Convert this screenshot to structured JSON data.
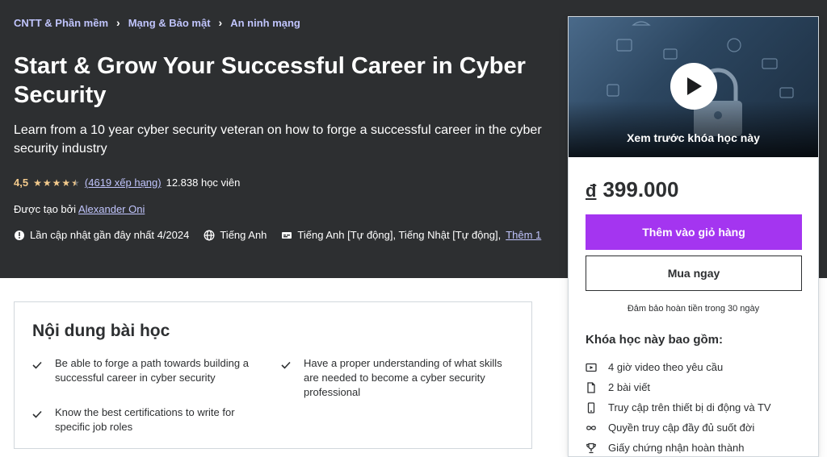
{
  "breadcrumb": {
    "items": [
      "CNTT & Phần mềm",
      "Mạng & Bảo mật",
      "An ninh mạng"
    ],
    "separator": ">"
  },
  "course": {
    "title": "Start & Grow Your Successful Career in Cyber Security",
    "subtitle": "Learn from a 10 year cyber security veteran on how to forge a successful career in the cyber security industry",
    "rating_value": "4,5",
    "rating_stars": 4.5,
    "rating_count": "(4619 xếp hạng)",
    "students": "12.838 học viên",
    "author_prefix": "Được tạo bởi",
    "author_name": "Alexander Oni",
    "updated": "Lần cập nhật gần đây nhất 4/2024",
    "language": "Tiếng Anh",
    "captions": "Tiếng Anh [Tự động], Tiếng Nhật [Tự động],",
    "captions_more": "Thêm 1"
  },
  "sidebar_card": {
    "preview_label": "Xem trước khóa học này",
    "currency": "đ",
    "price": "399.000",
    "add_to_cart": "Thêm vào giỏ hàng",
    "buy_now": "Mua ngay",
    "guarantee": "Đảm bảo hoàn tiền trong 30 ngày",
    "includes_title": "Khóa học này bao gồm:",
    "includes": [
      {
        "icon": "video-icon",
        "label": "4 giờ video theo yêu cầu"
      },
      {
        "icon": "article-icon",
        "label": "2 bài viết"
      },
      {
        "icon": "mobile-icon",
        "label": "Truy cập trên thiết bị di động và TV"
      },
      {
        "icon": "infinity-icon",
        "label": "Quyền truy cập đầy đủ suốt đời"
      },
      {
        "icon": "trophy-icon",
        "label": "Giấy chứng nhận hoàn thành"
      }
    ]
  },
  "what_you_learn": {
    "title": "Nội dung bài học",
    "items": [
      "Be able to forge a path towards building a successful career in cyber security",
      "Have a proper understanding of what skills are needed to become a cyber security professional",
      "Know the best certifications to write for specific job roles"
    ]
  },
  "colors": {
    "hero_bg": "#2d2f31",
    "accent_link": "#c0c4fc",
    "star": "#f3ca8c",
    "primary_button": "#a435f0"
  }
}
